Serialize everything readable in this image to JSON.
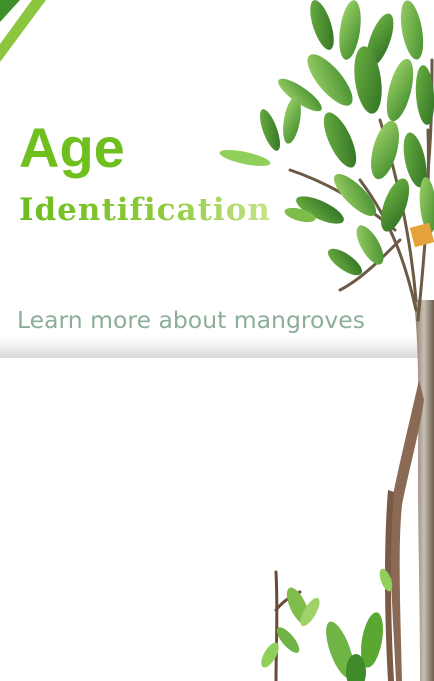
{
  "hero": {
    "title_line1": "Age",
    "title_line2": "Identification",
    "link_text": "Learn more about mangroves"
  },
  "colors": {
    "title_green": "#6fbf1f",
    "link_gray_green": "#8cae98",
    "leaf_green": "#5aa832"
  },
  "icons": [
    "corner-stripe-icon",
    "mangrove-tree-image",
    "seedling-image"
  ]
}
